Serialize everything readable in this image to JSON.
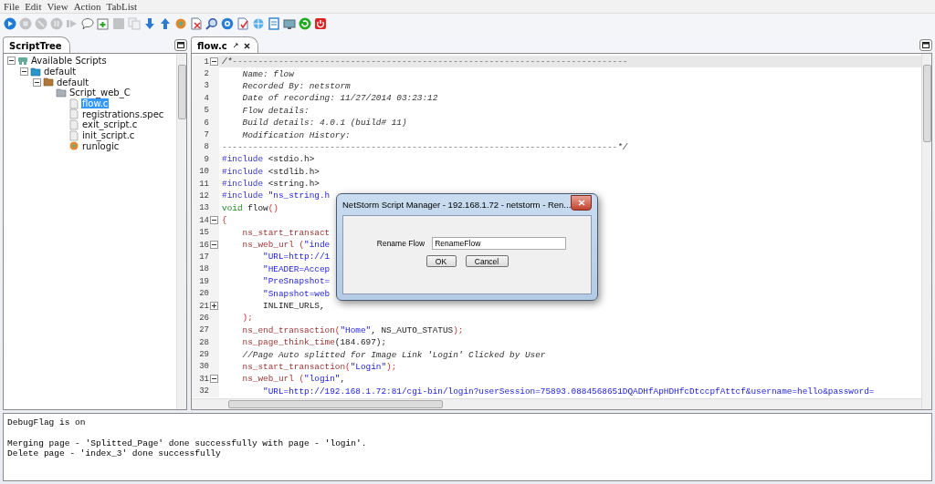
{
  "menu": [
    "File",
    "Edit",
    "View",
    "Action",
    "TabList"
  ],
  "toolbar": [
    {
      "kind": "play",
      "disabled": false
    },
    {
      "kind": "stop",
      "disabled": true
    },
    {
      "kind": "block",
      "disabled": true
    },
    {
      "kind": "pause",
      "disabled": true
    },
    {
      "kind": "step",
      "disabled": true
    },
    {
      "kind": "comment",
      "disabled": false
    },
    {
      "kind": "add",
      "disabled": false
    },
    {
      "kind": "save",
      "disabled": true
    },
    {
      "kind": "copy",
      "disabled": true
    },
    {
      "kind": "down",
      "disabled": false
    },
    {
      "kind": "up",
      "disabled": false
    },
    {
      "kind": "gear",
      "disabled": false
    },
    {
      "kind": "delete",
      "disabled": false
    },
    {
      "kind": "search",
      "disabled": false
    },
    {
      "kind": "settings",
      "disabled": false
    },
    {
      "kind": "check",
      "disabled": false
    },
    {
      "kind": "globe",
      "disabled": false
    },
    {
      "kind": "doc",
      "disabled": false
    },
    {
      "kind": "monitor",
      "disabled": false
    },
    {
      "kind": "refresh",
      "disabled": false
    },
    {
      "kind": "power",
      "disabled": false
    }
  ],
  "tree_tab": {
    "label": "ScriptTree",
    "selected": true
  },
  "tree": [
    {
      "label": "Available Scripts",
      "kind": "root",
      "selected": false,
      "expanded": true,
      "children": [
        {
          "label": "default",
          "kind": "blue-folder",
          "selected": false,
          "expanded": true,
          "children": [
            {
              "label": "default",
              "kind": "brown-folder",
              "selected": false,
              "expanded": true,
              "children": [
                {
                  "label": "Script_web_C",
                  "kind": "grey-folder",
                  "selected": false,
                  "children": [
                    {
                      "label": "flow.c",
                      "kind": "file",
                      "selected": true
                    },
                    {
                      "label": "registrations.spec",
                      "kind": "file",
                      "selected": false
                    },
                    {
                      "label": "exit_script.c",
                      "kind": "file",
                      "selected": false
                    },
                    {
                      "label": "init_script.c",
                      "kind": "file",
                      "selected": false
                    },
                    {
                      "label": "runlogic",
                      "kind": "logic",
                      "selected": false
                    }
                  ]
                }
              ]
            }
          ]
        }
      ]
    }
  ],
  "editor_tab": {
    "label": "flow.c",
    "selected": true
  },
  "code": [
    {
      "n": "1",
      "kind": "fold",
      "current": true,
      "tokens": [
        {
          "kind": "comment",
          "text": "/*-----------------------------------------------------------------------------"
        }
      ]
    },
    {
      "n": "2",
      "kind": "line",
      "current": false,
      "tokens": [
        {
          "kind": "comment",
          "text": "    Name: flow"
        }
      ]
    },
    {
      "n": "3",
      "kind": "line",
      "current": false,
      "tokens": [
        {
          "kind": "comment",
          "text": "    Recorded By: netstorm"
        }
      ]
    },
    {
      "n": "4",
      "kind": "line",
      "current": false,
      "tokens": [
        {
          "kind": "comment",
          "text": "    Date of recording: 11/27/2014 03:23:12"
        }
      ]
    },
    {
      "n": "5",
      "kind": "line",
      "current": false,
      "tokens": [
        {
          "kind": "comment",
          "text": "    Flow details:"
        }
      ]
    },
    {
      "n": "6",
      "kind": "line",
      "current": false,
      "tokens": [
        {
          "kind": "comment",
          "text": "    Build details: 4.0.1 (build# 11)"
        }
      ]
    },
    {
      "n": "7",
      "kind": "line",
      "current": false,
      "tokens": [
        {
          "kind": "comment",
          "text": "    Modification History:"
        }
      ]
    },
    {
      "n": "8",
      "kind": "line",
      "current": false,
      "tokens": [
        {
          "kind": "comment",
          "text": "-----------------------------------------------------------------------------*/"
        }
      ]
    },
    {
      "n": "9",
      "kind": "line",
      "current": false,
      "tokens": [
        {
          "kind": "directive",
          "text": "#include"
        },
        {
          "kind": "plain",
          "text": " <stdio.h>"
        }
      ]
    },
    {
      "n": "10",
      "kind": "line",
      "current": false,
      "tokens": [
        {
          "kind": "directive",
          "text": "#include"
        },
        {
          "kind": "plain",
          "text": " <stdlib.h>"
        }
      ]
    },
    {
      "n": "11",
      "kind": "line",
      "current": false,
      "tokens": [
        {
          "kind": "directive",
          "text": "#include"
        },
        {
          "kind": "plain",
          "text": " <string.h>"
        }
      ]
    },
    {
      "n": "12",
      "kind": "line",
      "current": false,
      "tokens": [
        {
          "kind": "directive",
          "text": "#include"
        },
        {
          "kind": "string",
          "text": " \"ns_string.h"
        }
      ]
    },
    {
      "n": "13",
      "kind": "line",
      "current": false,
      "tokens": [
        {
          "kind": "type",
          "text": "void"
        },
        {
          "kind": "plain",
          "text": " flow"
        },
        {
          "kind": "punct",
          "text": "()"
        }
      ]
    },
    {
      "n": "14",
      "kind": "fold",
      "current": false,
      "tokens": [
        {
          "kind": "punct",
          "text": "{"
        }
      ]
    },
    {
      "n": "15",
      "kind": "line",
      "current": false,
      "tokens": [
        {
          "kind": "func",
          "text": "    ns_start_transact"
        }
      ]
    },
    {
      "n": "16",
      "kind": "fold",
      "current": false,
      "tokens": [
        {
          "kind": "func",
          "text": "    ns_web_url"
        },
        {
          "kind": "punct",
          "text": " ("
        },
        {
          "kind": "string",
          "text": "\"inde"
        }
      ]
    },
    {
      "n": "17",
      "kind": "line",
      "current": false,
      "tokens": [
        {
          "kind": "string",
          "text": "        \"URL=http://1"
        }
      ]
    },
    {
      "n": "18",
      "kind": "line",
      "current": false,
      "tokens": [
        {
          "kind": "string",
          "text": "        \"HEADER=Accep"
        }
      ]
    },
    {
      "n": "19",
      "kind": "line",
      "current": false,
      "tokens": [
        {
          "kind": "string",
          "text": "        \"PreSnapshot="
        }
      ]
    },
    {
      "n": "20",
      "kind": "line",
      "current": false,
      "tokens": [
        {
          "kind": "string",
          "text": "        \"Snapshot=web"
        }
      ]
    },
    {
      "n": "21",
      "kind": "folded",
      "current": false,
      "tokens": [
        {
          "kind": "plain",
          "text": "        INLINE_URLS,"
        }
      ]
    },
    {
      "n": "26",
      "kind": "line",
      "current": false,
      "tokens": [
        {
          "kind": "punct",
          "text": "    );"
        }
      ]
    },
    {
      "n": "27",
      "kind": "line",
      "current": false,
      "tokens": [
        {
          "kind": "func",
          "text": "    ns_end_transaction"
        },
        {
          "kind": "punct",
          "text": "("
        },
        {
          "kind": "string",
          "text": "\"Home\""
        },
        {
          "kind": "plain",
          "text": ", NS_AUTO_STATUS"
        },
        {
          "kind": "punct",
          "text": ");"
        }
      ]
    },
    {
      "n": "28",
      "kind": "line",
      "current": false,
      "tokens": [
        {
          "kind": "func",
          "text": "    ns_page_think_time"
        },
        {
          "kind": "plain",
          "text": "(184.697);"
        }
      ]
    },
    {
      "n": "29",
      "kind": "line",
      "current": false,
      "tokens": [
        {
          "kind": "comment",
          "text": "    //Page Auto splitted for Image Link 'Login' Clicked by User"
        }
      ]
    },
    {
      "n": "30",
      "kind": "line",
      "current": false,
      "tokens": [
        {
          "kind": "func",
          "text": "    ns_start_transaction"
        },
        {
          "kind": "punct",
          "text": "("
        },
        {
          "kind": "string",
          "text": "\"Login\""
        },
        {
          "kind": "punct",
          "text": ");"
        }
      ]
    },
    {
      "n": "31",
      "kind": "fold",
      "current": false,
      "tokens": [
        {
          "kind": "func",
          "text": "    ns_web_url"
        },
        {
          "kind": "punct",
          "text": " ("
        },
        {
          "kind": "string",
          "text": "\"login\""
        },
        {
          "kind": "plain",
          "text": ","
        }
      ]
    },
    {
      "n": "32",
      "kind": "line",
      "current": false,
      "tokens": [
        {
          "kind": "string",
          "text": "        \"URL=http://192.168.1.72:81/cgi-bin/login?userSession=75893.0884568651DQADHfApHDHfcDtccpfAttcf&username=hello&password="
        }
      ]
    }
  ],
  "console": [
    [
      "DebugFlag is on"
    ],
    [
      "Merging page - 'Splitted_Page' done successfully with page - 'login'.",
      "Delete page - 'index_3' done successfully"
    ]
  ],
  "dialog": {
    "title": "NetStorm  Script Manager - 192.168.1.72 - netstorm - Ren...",
    "label": "Rename Flow",
    "value": "RenameFlow",
    "buttons": [
      "OK",
      "Cancel"
    ]
  }
}
